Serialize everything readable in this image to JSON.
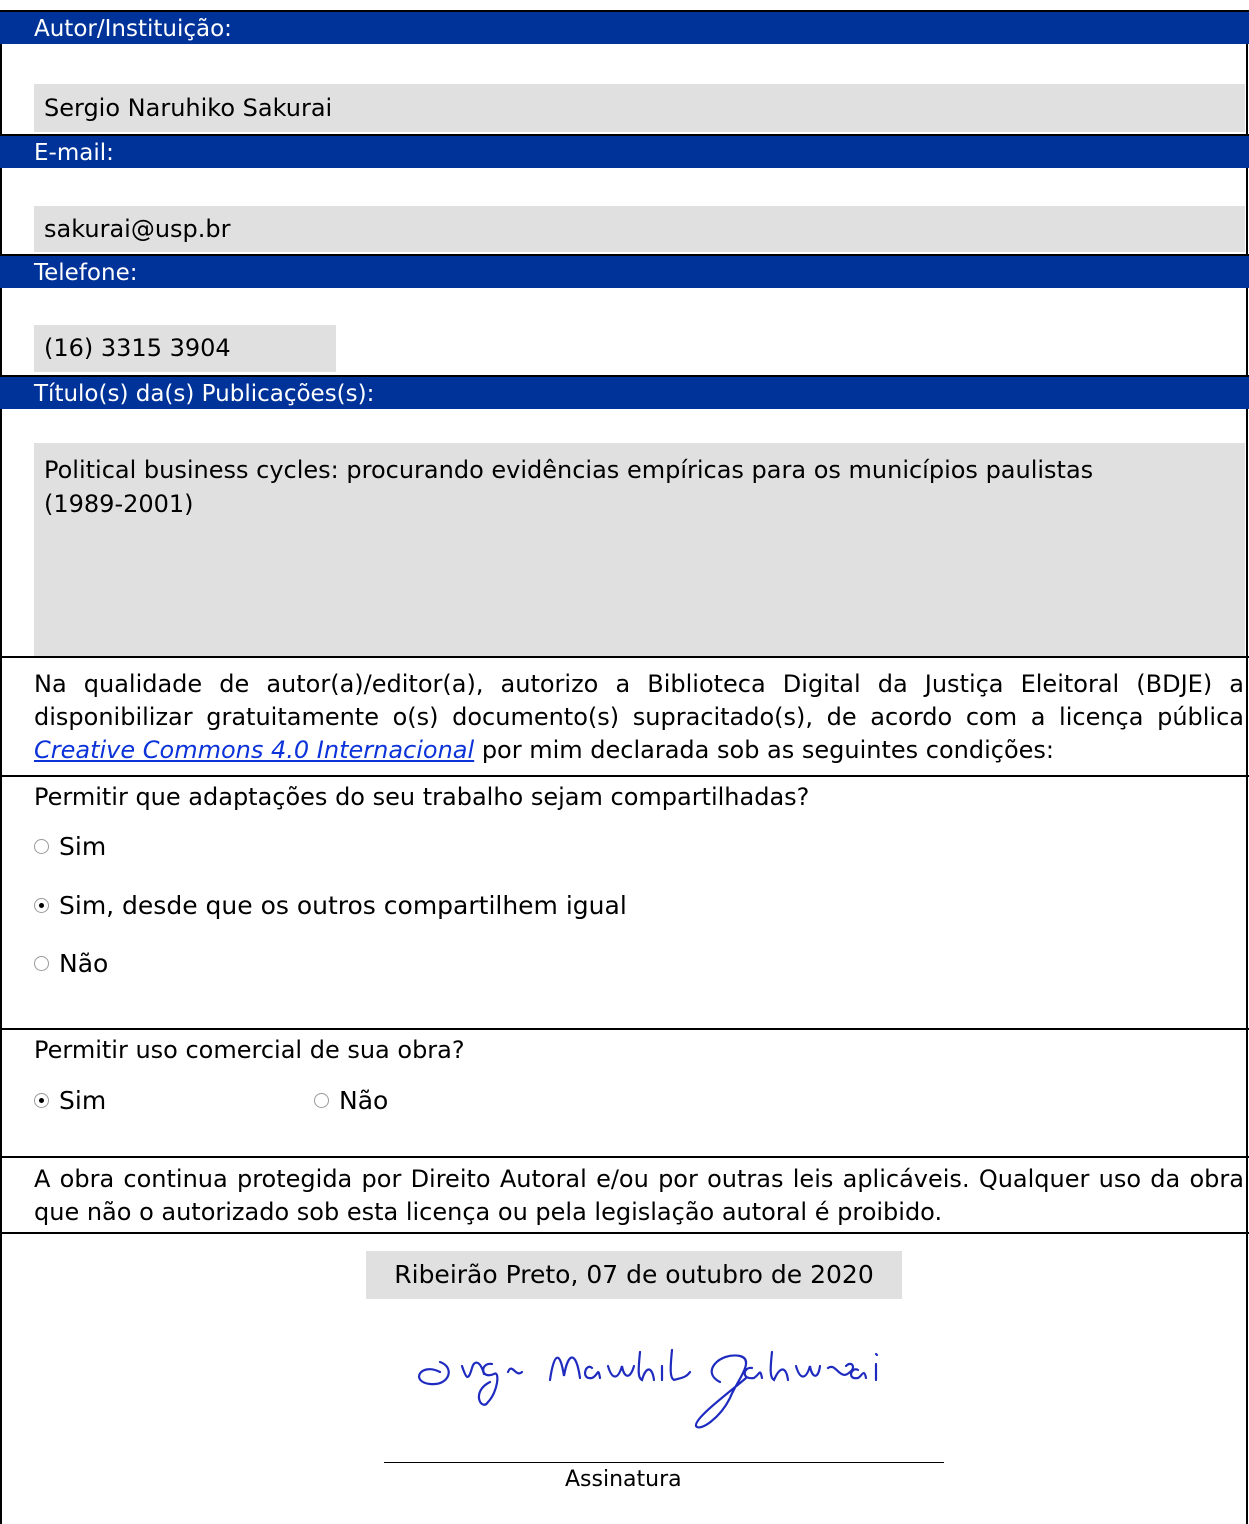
{
  "sections": {
    "author_label": "Autor/Instituição:",
    "author_value": "Sergio Naruhiko Sakurai",
    "email_label": "E-mail:",
    "email_value": "sakurai@usp.br",
    "phone_label": "Telefone:",
    "phone_value": "(16) 3315 3904",
    "title_label": "Título(s) da(s) Publicações(s):",
    "title_value_line1": "Political business cycles: procurando evidências empíricas para os municípios paulistas",
    "title_value_line2": "(1989-2001)"
  },
  "authorization": {
    "text_before_link": "Na qualidade de autor(a)/editor(a), autorizo a Biblioteca Digital da Justiça Eleitoral (BDJE) a disponibilizar gratuitamente o(s) documento(s) supracitado(s), de acordo com a licença pública ",
    "link_text": "Creative Commons 4.0 Internacional",
    "text_after_link": " por mim declarada sob as seguintes condições:"
  },
  "question_adaptations": {
    "label": "Permitir que adaptações do seu trabalho sejam compartilhadas?",
    "options": [
      "Sim",
      "Sim, desde que os outros compartilhem igual",
      "Não"
    ],
    "selected": "Sim, desde que os outros compartilhem igual"
  },
  "question_commercial": {
    "label": "Permitir uso comercial de sua obra?",
    "options": [
      "Sim",
      "Não"
    ],
    "selected": "Sim"
  },
  "notice": "A obra continua protegida por Direito Autoral e/ou por outras leis aplicáveis. Qualquer uso da obra que não o autorizado sob esta licença ou pela legislação autoral é proibido.",
  "place_date": "Ribeirão Preto, 07 de outubro de 2020",
  "signature_name": "Sergio Naruhiko Sakurai",
  "signature_label": "Assinatura",
  "colors": {
    "header_bg": "#003399",
    "field_bg": "#e0e0e0",
    "link": "#0b33d9"
  }
}
